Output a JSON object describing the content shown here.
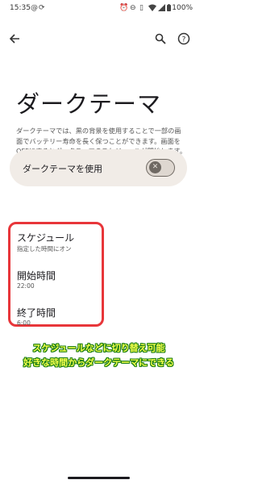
{
  "status_bar": {
    "time": "15:35",
    "battery": "100%"
  },
  "page": {
    "title": "ダークテーマ",
    "description": "ダークテーマでは、黒の背景を使用することで一部の画面でバッテリー寿命を長く保つことができます。画面をOFFにするとダークテーマのスケジュールが開始します。"
  },
  "dark_theme_toggle": {
    "label": "ダークテーマを使用",
    "state": "off"
  },
  "schedule": {
    "title": "スケジュール",
    "value": "指定した時間にオン"
  },
  "start_time": {
    "title": "開始時間",
    "value": "22:00"
  },
  "end_time": {
    "title": "終了時間",
    "value": "6:00"
  },
  "caption": {
    "line1": "スケジュールなどに切り替え可能",
    "line2": "好きな時間からダークテーマにできる"
  },
  "colors": {
    "highlight_border": "#e8363a",
    "caption_text": "#f3ff4a",
    "caption_outline": "#1a7d14",
    "card_bg": "#f1ece7"
  }
}
